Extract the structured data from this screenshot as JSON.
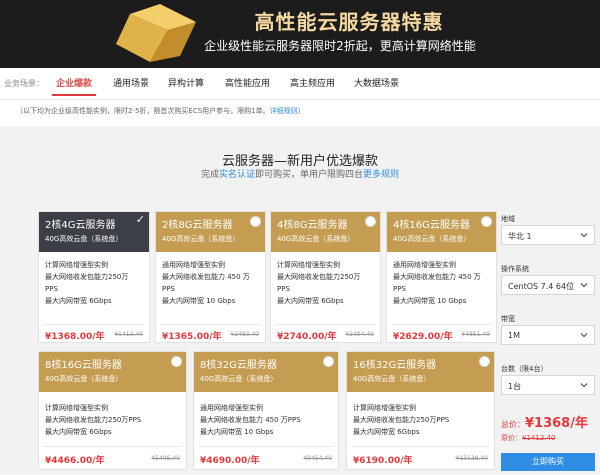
{
  "banner": {
    "title": "高性能云服务器特惠",
    "subtitle": "企业级性能云服务器限时2折起，更高计算网络性能"
  },
  "tabs": {
    "scene_label": "业务场景：",
    "items": [
      "企业爆款",
      "通用场景",
      "异构计算",
      "高性能应用",
      "高主频应用",
      "大数据场景"
    ]
  },
  "notice": {
    "text": "（以下均为企业级高性能实例，限时2-5折，限首次购买ECS用户参与，限购1单。",
    "link": "详细规则",
    "close": "）"
  },
  "section": {
    "title": "云服务器—新用户优选爆款",
    "sub_pre": "完成",
    "sub_link": "实名认证",
    "sub_mid": "即可购买，单用户限购四台",
    "sub_more": "更多规则"
  },
  "cards": [
    {
      "name": "2核4G云服务器",
      "disk": "40G高效云盘（系统盘）",
      "f1": "计算网络增强型实例",
      "f2": "最大网络收发包能力250万",
      "f2b": "PPS",
      "f3": "最大内网带宽 6Gbps",
      "price": "¥1368.00/年",
      "orig": "¥1412.40"
    },
    {
      "name": "2核8G云服务器",
      "disk": "40G高效云盘（系统盘）",
      "f1": "通用网络增强型实例",
      "f2": "最大网络收发包能力 450 万",
      "f2b": "PPS",
      "f3": "最大内网带宽 10 Gbps",
      "price": "¥1365.00/年",
      "orig": "¥2483.40"
    },
    {
      "name": "4核8G云服务器",
      "disk": "40G高效云盘（系统盘）",
      "f1": "计算网络增强型实例",
      "f2": "最大网络收发包能力250万",
      "f2b": "PPS",
      "f3": "最大内网带宽 6Gbps",
      "price": "¥2740.00/年",
      "orig": "¥2404.40"
    },
    {
      "name": "4核16G云服务器",
      "disk": "40G高效云盘（系统盘）",
      "f1": "通用网络增强型实例",
      "f2": "最大网络收发包能力 450 万",
      "f2b": "PPS",
      "f3": "最大内网带宽 10 Gbps",
      "price": "¥2629.00/年",
      "orig": "¥4851.40"
    },
    {
      "name": "8核16G云服务器",
      "disk": "40G高效云盘（系统盘）",
      "f1": "计算网络增强型实例",
      "f2": "最大网络收发包能力250万PPS",
      "f3": "最大内网带宽 6Gbps",
      "price": "¥4466.00/年",
      "orig": "¥5406.40"
    },
    {
      "name": "8核32G云服务器",
      "disk": "40G高效云盘（系统盘）",
      "f1": "通用网络增强型实例",
      "f2": "最大网络收发包能力 450 万PPS",
      "f3": "最大内网带宽 10 Gbps",
      "price": "¥4690.00/年",
      "orig": "¥9454.40"
    },
    {
      "name": "16核32G云服务器",
      "disk": "40G高效云盘（系统盘）",
      "f1": "计算网络增强型实例",
      "f2": "最大网络收发包能力250万PPS",
      "f3": "最大内网带宽 6Gbps",
      "price": "¥6190.00/年",
      "orig": "¥13138.40"
    }
  ],
  "panel": {
    "region_label": "地域",
    "region_value": "华北 1",
    "os_label": "操作系统",
    "os_value": "CentOS 7.4 64位",
    "bandwidth_label": "带宽",
    "bandwidth_value": "1M",
    "count_label": "台数（限4台）",
    "count_value": "1台",
    "total_label": "总价：",
    "total_value": "¥1368/年",
    "total_orig": "¥1412.40",
    "buy_label": "立即购买"
  },
  "colors": {
    "accent_red": "#e4393c",
    "gold": "#c59d52",
    "selected_dark": "#3c3f45",
    "link_blue": "#2f8de4"
  },
  "icons": {
    "check": "check-icon",
    "radio": "radio-unchecked-icon",
    "chevron": "chevron-down-icon"
  }
}
